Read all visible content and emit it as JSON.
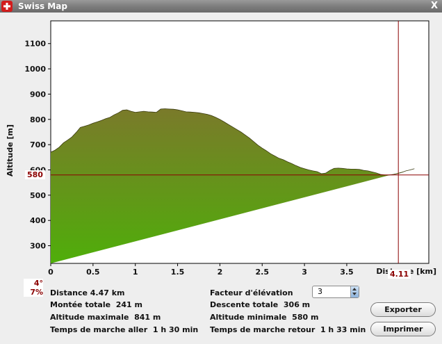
{
  "window": {
    "title": "Swiss Map",
    "close_glyph": "X",
    "icon": "swiss-flag-icon"
  },
  "colors": {
    "profile_top": "#7a7a2a",
    "profile_bottom": "#4fae0a",
    "cursor_line": "#8b0000",
    "plot_bg": "#ffffff"
  },
  "chart_data": {
    "type": "area",
    "title": "",
    "xlabel": "Distance [km]",
    "ylabel": "Altitude [m]",
    "xlim": [
      0,
      4.47
    ],
    "ylim": [
      230,
      1190
    ],
    "xticks": [
      "0",
      "0.5",
      "1",
      "1.5",
      "2",
      "2.5",
      "3",
      "3.5"
    ],
    "yticks": [
      "300",
      "400",
      "500",
      "600",
      "700",
      "800",
      "900",
      "1000",
      "1100"
    ],
    "grid": false,
    "x": [
      0,
      0.05,
      0.1,
      0.15,
      0.2,
      0.25,
      0.3,
      0.35,
      0.4,
      0.45,
      0.5,
      0.55,
      0.6,
      0.65,
      0.7,
      0.75,
      0.8,
      0.85,
      0.9,
      0.95,
      1.0,
      1.05,
      1.1,
      1.15,
      1.2,
      1.25,
      1.3,
      1.35,
      1.4,
      1.45,
      1.5,
      1.55,
      1.6,
      1.65,
      1.7,
      1.75,
      1.8,
      1.85,
      1.9,
      1.95,
      2.0,
      2.05,
      2.1,
      2.15,
      2.2,
      2.25,
      2.3,
      2.35,
      2.4,
      2.45,
      2.5,
      2.55,
      2.6,
      2.65,
      2.7,
      2.75,
      2.8,
      2.85,
      2.9,
      2.95,
      3.0,
      3.05,
      3.1,
      3.15,
      3.2,
      3.25,
      3.3,
      3.35,
      3.4,
      3.45,
      3.5,
      3.55,
      3.6,
      3.65,
      3.7,
      3.75,
      3.8,
      3.85,
      3.9,
      3.95,
      4.0,
      4.05,
      4.1,
      4.15,
      4.2,
      4.25,
      4.3,
      4.35,
      4.4,
      4.47
    ],
    "y": [
      670,
      678,
      690,
      707,
      718,
      730,
      748,
      768,
      773,
      778,
      785,
      790,
      796,
      803,
      808,
      818,
      826,
      836,
      838,
      832,
      828,
      830,
      832,
      830,
      829,
      828,
      841,
      842,
      841,
      840,
      838,
      834,
      830,
      829,
      828,
      826,
      823,
      820,
      815,
      808,
      800,
      790,
      780,
      770,
      760,
      750,
      738,
      726,
      712,
      698,
      686,
      676,
      664,
      655,
      646,
      640,
      632,
      625,
      617,
      610,
      605,
      600,
      596,
      593,
      585,
      587,
      598,
      606,
      607,
      606,
      604,
      603,
      603,
      602,
      598,
      596,
      592,
      588,
      582,
      580,
      580,
      582,
      585,
      590,
      596,
      600,
      605
    ],
    "cursor": {
      "x": 4.11,
      "x_label": "4.11",
      "y": 580,
      "y_label": "580",
      "slope_deg": "4°",
      "slope_pct": "7%"
    }
  },
  "stats": {
    "distance": "Distance 4.47 km",
    "ascent": "Montée totale  241 m",
    "max_alt": "Altitude maximale  841 m",
    "time_out": "Temps de marche aller  1 h 30 min",
    "factor_label": "Facteur d'élévation",
    "descent": "Descente totale  306 m",
    "min_alt": "Altitude minimale  580 m",
    "time_back": "Temps de marche retour  1 h 33 min"
  },
  "factor": {
    "value": "3"
  },
  "buttons": {
    "export": "Exporter",
    "print": "Imprimer"
  }
}
